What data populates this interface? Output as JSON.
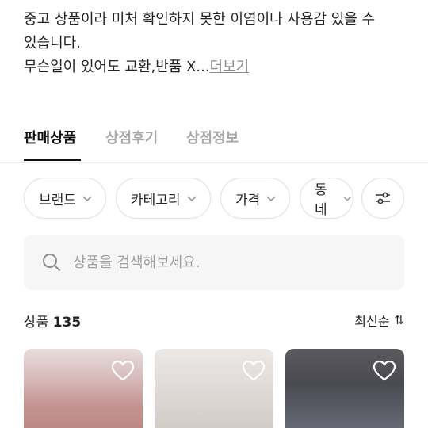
{
  "description": {
    "line1": "중고 상품이라 미처 확인하지 못한 이염이나 사용감 있을 수",
    "line2": "있습니다.",
    "line3": "무슨일이 있어도 교환,반품 X...",
    "more_label": "더보기"
  },
  "tabs": [
    {
      "label": "판매상품",
      "active": true
    },
    {
      "label": "상점후기",
      "active": false
    },
    {
      "label": "상점정보",
      "active": false
    }
  ],
  "filters": [
    {
      "label": "브랜드"
    },
    {
      "label": "카테고리"
    },
    {
      "label": "가격"
    },
    {
      "label": "동네"
    }
  ],
  "filter_settings_icon": "sliders-icon",
  "search": {
    "placeholder": "상품을 검색해보세요.",
    "value": ""
  },
  "products": {
    "label": "상품",
    "count": "135"
  },
  "sort": {
    "label": "최신순",
    "icon": "sort-arrows-icon"
  },
  "thumbnails": [
    {
      "alt": "pink dress product",
      "icon": "heart-icon"
    },
    {
      "alt": "white top product",
      "icon": "heart-icon"
    },
    {
      "alt": "gray lace product",
      "icon": "heart-icon"
    }
  ],
  "colors": {
    "accent": "#111111",
    "muted": "#a9a9a9",
    "search_bg": "#f6f6f6"
  }
}
